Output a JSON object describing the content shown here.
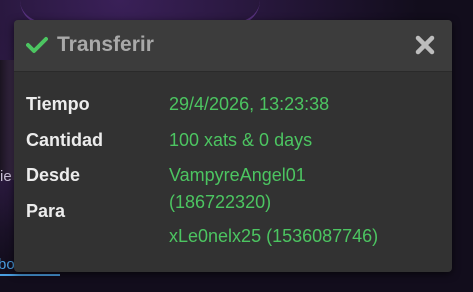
{
  "dialog": {
    "title": "Transferir",
    "check_icon": "check-icon",
    "close_icon": "close-icon",
    "accent_color": "#4cc561",
    "rows": [
      {
        "label": "Tiempo",
        "value": "29/4/2026, 13:23:38"
      },
      {
        "label": "Cantidad",
        "value": "100 xats & 0 days"
      },
      {
        "label": "Desde",
        "value_lines": [
          "VampyreAngel01",
          "(186722320)"
        ]
      },
      {
        "label": "Para",
        "value": "xLe0nelx25 (1536087746)"
      }
    ]
  },
  "background": {
    "partial_link": "bo"
  }
}
